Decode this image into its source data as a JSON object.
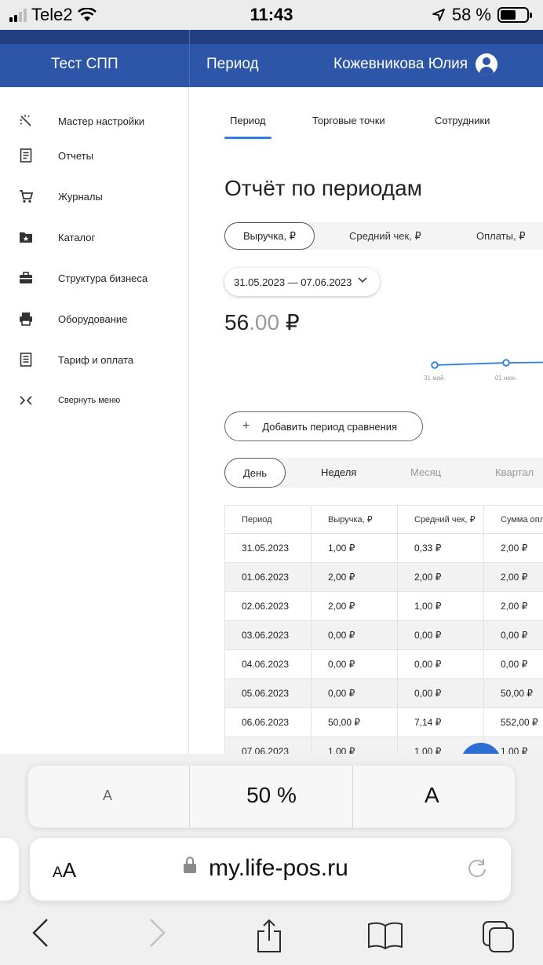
{
  "status_bar": {
    "carrier": "Tele2",
    "time": "11:43",
    "battery": "58 %",
    "battery_level": 0.58,
    "icons": [
      "signal-icon",
      "wifi-icon",
      "location-arrow-icon",
      "battery-icon"
    ]
  },
  "header": {
    "company": "Тест СПП",
    "section": "Период",
    "user": "Кожевникова Юлия",
    "accent_color": "#2d56a8"
  },
  "sidebar": {
    "items": [
      {
        "label": "Мастер настройки",
        "icon": "magic-wand-icon"
      },
      {
        "label": "Отчеты",
        "icon": "report-icon"
      },
      {
        "label": "Журналы",
        "icon": "cart-icon"
      },
      {
        "label": "Каталог",
        "icon": "folder-star-icon"
      },
      {
        "label": "Структура бизнеса",
        "icon": "briefcase-icon"
      },
      {
        "label": "Оборудование",
        "icon": "printer-icon"
      },
      {
        "label": "Тариф и оплата",
        "icon": "receipt-icon"
      },
      {
        "label": "Свернуть меню",
        "icon": "collapse-icon"
      }
    ]
  },
  "tabs": [
    "Период",
    "Торговые точки",
    "Сотрудники"
  ],
  "report": {
    "title": "Отчёт по периодам",
    "metrics": [
      "Выручка, ₽",
      "Средний чек, ₽",
      "Оплаты, ₽"
    ],
    "date_range": "31.05.2023 — 07.06.2023",
    "total_int": "56",
    "total_dec": ".00",
    "total_currency": " ₽",
    "add_compare": "Добавить период сравнения",
    "granularity": [
      "День",
      "Неделя",
      "Месяц",
      "Квартал"
    ]
  },
  "chart_data": {
    "type": "line",
    "x": [
      "31 май.",
      "01 июн."
    ],
    "values": [
      1,
      2
    ],
    "title": "",
    "xlabel": "",
    "ylabel": "",
    "color": "#2f7de0"
  },
  "table": {
    "headers": [
      "Период",
      "Выручка, ₽",
      "Средний чек, ₽",
      "Сумма опл"
    ],
    "rows": [
      [
        "31.05.2023",
        "1,00 ₽",
        "0,33 ₽",
        "2,00 ₽"
      ],
      [
        "01.06.2023",
        "2,00 ₽",
        "2,00 ₽",
        "2,00 ₽"
      ],
      [
        "02.06.2023",
        "2,00 ₽",
        "1,00 ₽",
        "2,00 ₽"
      ],
      [
        "03.06.2023",
        "0,00 ₽",
        "0,00 ₽",
        "0,00 ₽"
      ],
      [
        "04.06.2023",
        "0,00 ₽",
        "0,00 ₽",
        "0,00 ₽"
      ],
      [
        "05.06.2023",
        "0,00 ₽",
        "0,00 ₽",
        "50,00 ₽"
      ],
      [
        "06.06.2023",
        "50,00 ₽",
        "7,14 ₽",
        "552,00 ₽"
      ],
      [
        "07.06.2023",
        "1,00 ₽",
        "1,00 ₽",
        "1,00 ₽"
      ]
    ]
  },
  "font_panel": {
    "smaller": "A",
    "zoom": "50 %",
    "larger": "A"
  },
  "browser": {
    "aa_small": "A",
    "aa_large": "A",
    "url": "my.life-pos.ru"
  }
}
